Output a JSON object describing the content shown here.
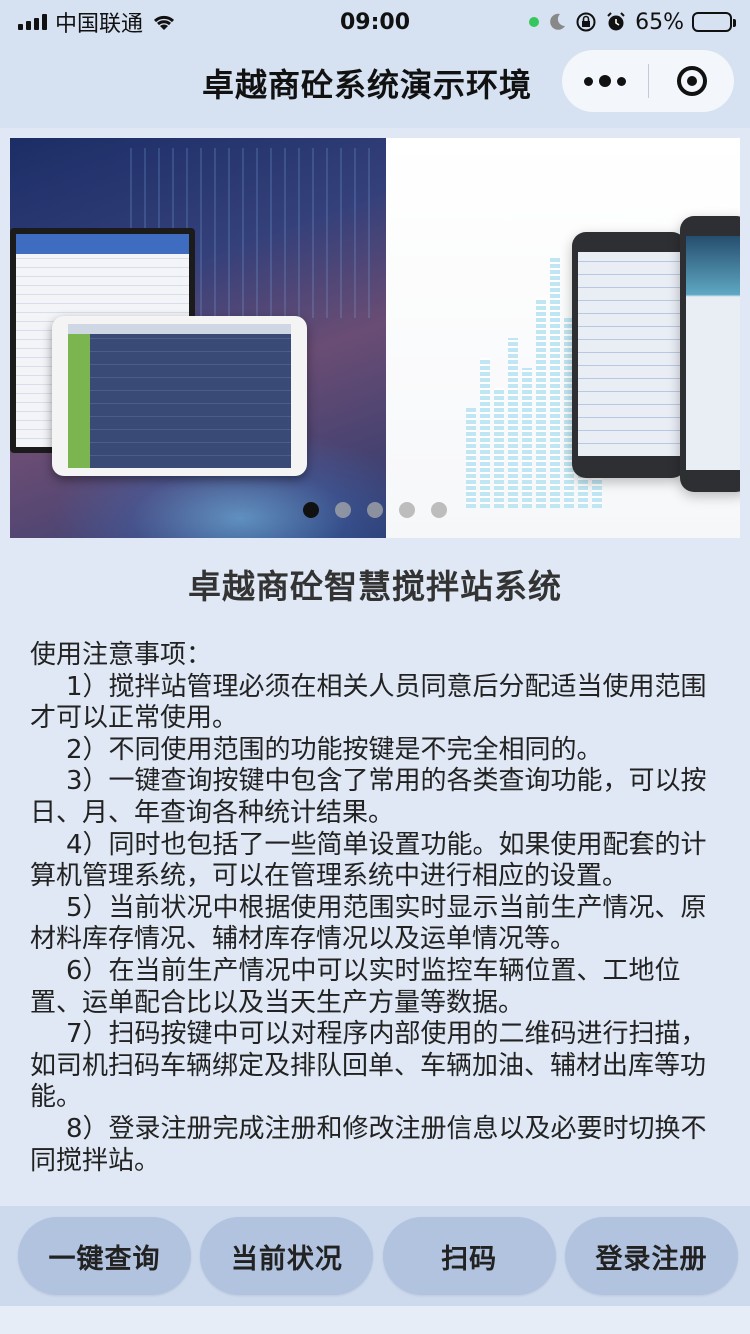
{
  "status_bar": {
    "carrier": "中国联通",
    "time": "09:00",
    "battery_percent": "65%",
    "battery_level": 0.65,
    "icons": [
      "signal-icon",
      "wifi-icon",
      "moon-icon",
      "rotation-lock-icon",
      "alarm-icon",
      "battery-icon"
    ]
  },
  "nav": {
    "title": "卓越商砼系统演示环境",
    "more_icon": "more-dots-icon",
    "close_icon": "target-circle-icon"
  },
  "banner": {
    "slides": 5,
    "active_index": 0
  },
  "main_title": "卓越商砼智慧搅拌站系统",
  "notes": {
    "heading": "使用注意事项：",
    "items": [
      "1）搅拌站管理必须在相关人员同意后分配适当使用范围才可以正常使用。",
      "2）不同使用范围的功能按键是不完全相同的。",
      "3）一键查询按键中包含了常用的各类查询功能，可以按日、月、年查询各种统计结果。",
      "4）同时也包括了一些简单设置功能。如果使用配套的计算机管理系统，可以在管理系统中进行相应的设置。",
      "5）当前状况中根据使用范围实时显示当前生产情况、原材料库存情况、辅材库存情况以及运单情况等。",
      "6）在当前生产情况中可以实时监控车辆位置、工地位置、运单配合比以及当天生产方量等数据。",
      "7）扫码按键中可以对程序内部使用的二维码进行扫描，如司机扫码车辆绑定及排队回单、车辆加油、辅材出库等功能。",
      "8）登录注册完成注册和修改注册信息以及必要时切换不同搅拌站。"
    ]
  },
  "bottom_buttons": {
    "query": "一键查询",
    "status": "当前状况",
    "scan": "扫码",
    "login": "登录注册"
  },
  "colors": {
    "background": "#dfe8f4",
    "header": "#d6e1f1",
    "button": "#b2c3e0"
  }
}
